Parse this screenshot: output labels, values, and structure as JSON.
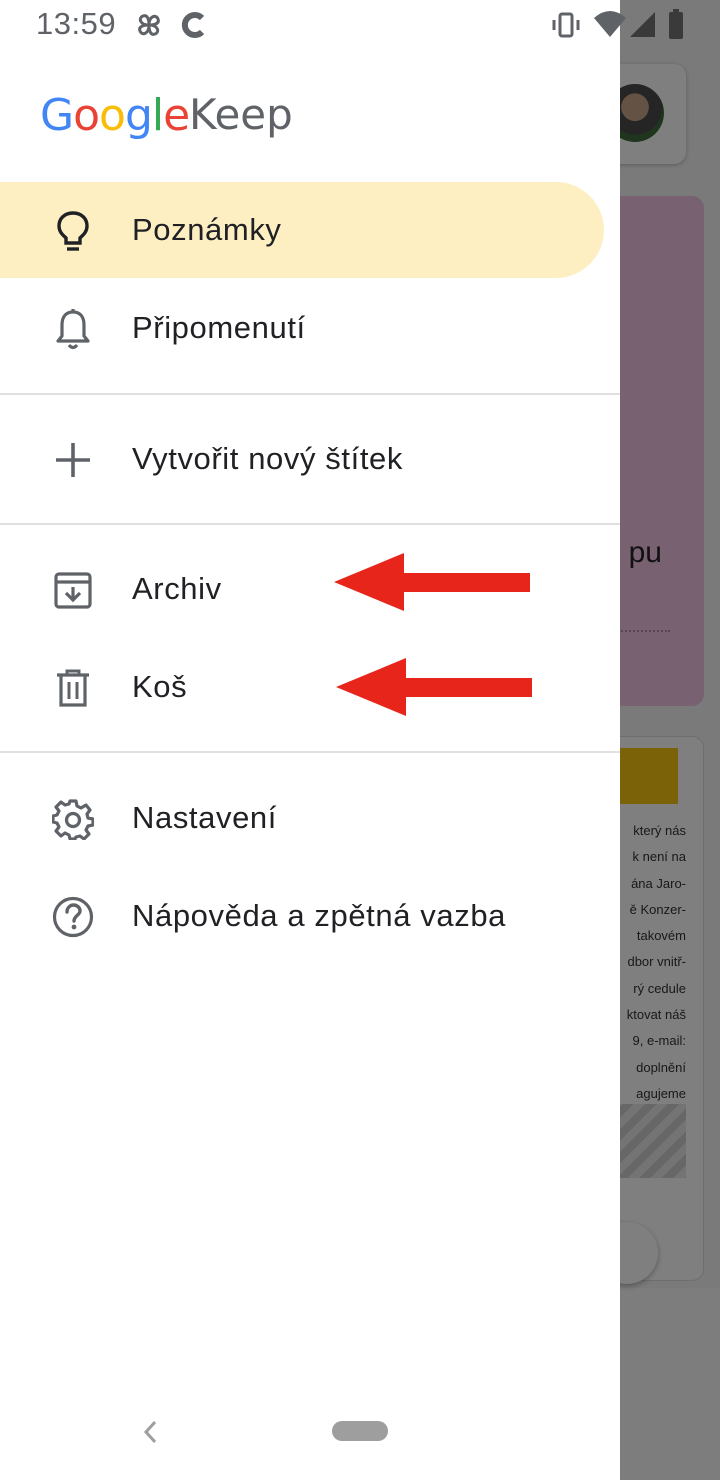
{
  "status_bar": {
    "time": "13:59",
    "icons": [
      "pinwheel-icon",
      "c-app-icon",
      "vibrate-icon",
      "wifi-icon",
      "signal-icon",
      "battery-icon"
    ]
  },
  "logo": {
    "google_letters": [
      "G",
      "o",
      "o",
      "g",
      "l",
      "e"
    ],
    "product": "Keep"
  },
  "menu": {
    "notes": {
      "label": "Poznámky",
      "icon": "lightbulb-icon",
      "selected": true
    },
    "reminders": {
      "label": "Připomenutí",
      "icon": "bell-icon"
    },
    "new_label": {
      "label": "Vytvořit nový štítek",
      "icon": "plus-icon"
    },
    "archive": {
      "label": "Archiv",
      "icon": "archive-icon"
    },
    "trash": {
      "label": "Koš",
      "icon": "trash-icon"
    },
    "settings": {
      "label": "Nastavení",
      "icon": "gear-icon"
    },
    "help": {
      "label": "Nápověda a zpětná vazba",
      "icon": "help-icon"
    }
  },
  "annotations": {
    "arrow_color": "#e8251a",
    "targets": [
      "archive",
      "trash"
    ]
  },
  "background": {
    "note_fragment": "pu",
    "note_lines": [
      "který nás",
      "k není na",
      "ána Jaro-",
      "ě Konzer-",
      "takovém",
      "dbor vnitř-",
      "rý cedule",
      "ktovat náš",
      "9, e-mail:",
      "doplnění",
      "agujeme"
    ]
  },
  "colors": {
    "selected_bg": "#feefc3",
    "text": "#202124",
    "icon": "#5f6368",
    "divider": "#e0e0e0"
  }
}
